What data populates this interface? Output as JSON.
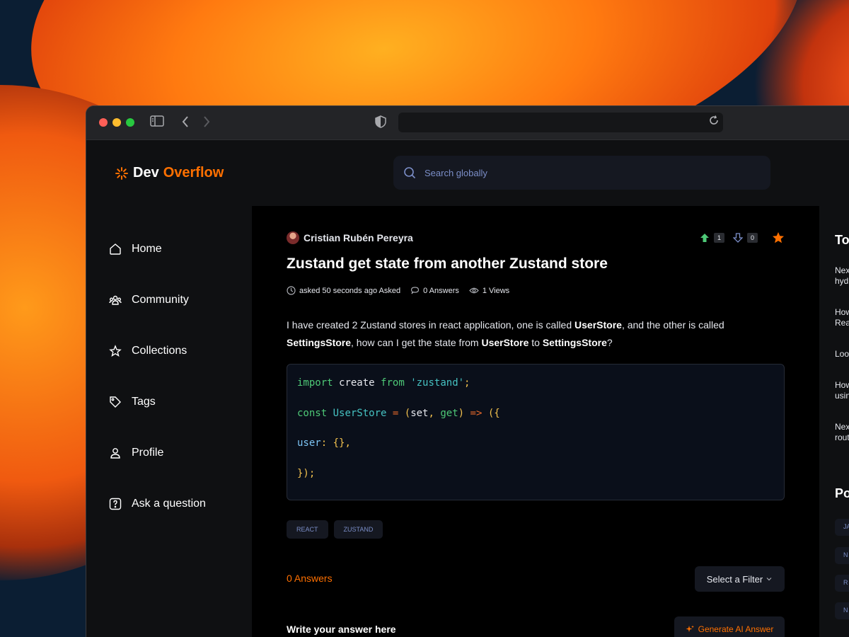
{
  "app": {
    "logo_part1": "Dev",
    "logo_part2": "Overflow",
    "search_placeholder": "Search globally"
  },
  "sidebar": {
    "items": [
      {
        "label": "Home",
        "icon": "home-icon"
      },
      {
        "label": "Community",
        "icon": "users-icon"
      },
      {
        "label": "Collections",
        "icon": "star-icon"
      },
      {
        "label": "Tags",
        "icon": "tag-icon"
      },
      {
        "label": "Profile",
        "icon": "user-icon"
      },
      {
        "label": "Ask a question",
        "icon": "question-icon"
      }
    ]
  },
  "question": {
    "author": "Cristian Rubén Pereyra",
    "upvotes": "1",
    "downvotes": "0",
    "title": "Zustand get state from another Zustand store",
    "asked": "asked 50 seconds ago Asked",
    "answers_meta": "0 Answers",
    "views_meta": "1 Views",
    "body_parts": [
      "I have created 2 Zustand stores in react application, one is called ",
      "UserStore",
      ", and the other is called ",
      "SettingsStore",
      ", how can I get the state from ",
      "UserStore",
      " to ",
      "SettingsStore",
      "?"
    ],
    "code_lines": [
      "import create from 'zustand';",
      "const UserStore = (set, get) => ({",
      "user: {},",
      "});"
    ],
    "tags": [
      "REACT",
      "ZUSTAND"
    ]
  },
  "answers": {
    "count_label": "0 Answers",
    "filter_label": "Select a Filter",
    "write_label": "Write your answer here",
    "generate_label": "Generate AI Answer"
  },
  "rightbar": {
    "top_title": "To",
    "questions": [
      {
        "line1": "Nex",
        "line2": "hyd"
      },
      {
        "line1": "How",
        "line2": "Rea"
      },
      {
        "line1": "Loo",
        "line2": ""
      },
      {
        "line1": "How",
        "line2": "usin"
      },
      {
        "line1": "Nex",
        "line2": "rout"
      }
    ],
    "tags_title": "Po",
    "tags": [
      "JA",
      "N",
      "R",
      "N"
    ]
  },
  "colors": {
    "accent": "#ff7000",
    "upvote": "#4ec977",
    "downvote": "#7b8ec8"
  }
}
